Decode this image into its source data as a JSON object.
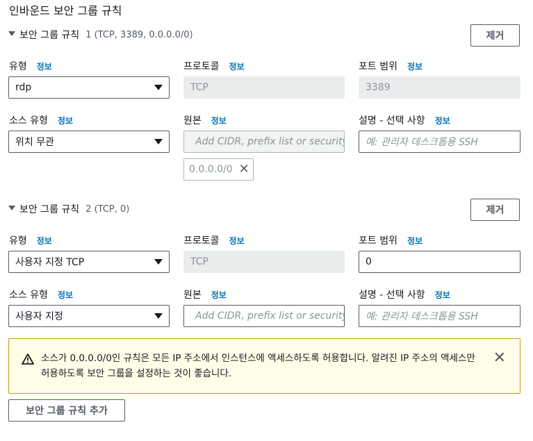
{
  "section_title": "인바운드 보안 그룹 규칙",
  "info_label": "정보",
  "remove_label": "제거",
  "rules": [
    {
      "title": "보안 그룹 규칙",
      "subtitle": "1 (TCP, 3389, 0.0.0.0/0)",
      "type_label": "유형",
      "type_value": "rdp",
      "protocol_label": "프로토콜",
      "protocol_value": "TCP",
      "port_label": "포트 범위",
      "port_value": "3389",
      "source_type_label": "소스 유형",
      "source_type_value": "위치 무관",
      "source_label": "원본",
      "source_placeholder": "Add CIDR, prefix list or security",
      "source_token": "0.0.0.0/0",
      "desc_label": "설명 - 선택 사항",
      "desc_placeholder": "예: 관리자 데스크톱용 SSH"
    },
    {
      "title": "보안 그룹 규칙",
      "subtitle": "2 (TCP, 0)",
      "type_label": "유형",
      "type_value": "사용자 지정 TCP",
      "protocol_label": "프로토콜",
      "protocol_value": "TCP",
      "port_label": "포트 범위",
      "port_value": "0",
      "source_type_label": "소스 유형",
      "source_type_value": "사용자 지정",
      "source_label": "원본",
      "source_placeholder": "Add CIDR, prefix list or security",
      "desc_label": "설명 - 선택 사항",
      "desc_placeholder": "예: 관리자 데스크톱용 SSH"
    }
  ],
  "alert": {
    "text": "소스가 0.0.0.0/0인 규칙은 모든 IP 주소에서 인스턴스에 액세스하도록 허용합니다. 알려진 IP 주소의 액세스만 허용하도록 보안 그룹을 설정하는 것이 좋습니다."
  },
  "add_rule_label": "보안 그룹 규칙 추가",
  "colors": {
    "link": "#0073bb",
    "alert_bg": "#fffce8",
    "alert_border": "#c7a100",
    "disabled_bg": "#eaeded"
  }
}
